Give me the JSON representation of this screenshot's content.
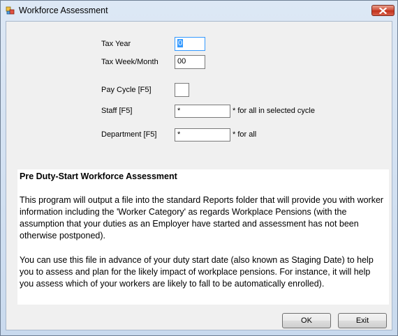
{
  "window": {
    "title": "Workforce Assessment",
    "close_label": "✕"
  },
  "form": {
    "tax_year_label": "Tax Year",
    "tax_year_value": "0",
    "tax_week_label": "Tax Week/Month",
    "tax_week_value": "00",
    "pay_cycle_label": "Pay Cycle [F5]",
    "pay_cycle_value": "",
    "staff_label": "Staff [F5]",
    "staff_value": "*",
    "staff_hint": "* for all in selected cycle",
    "department_label": "Department [F5]",
    "department_value": "*",
    "department_hint": "* for all"
  },
  "info": {
    "heading": "Pre Duty-Start Workforce Assessment",
    "paragraph1": "This program will output a file into the standard Reports folder that will provide you with worker information including the 'Worker Category' as regards Workplace Pensions (with the assumption that your duties as an Employer have started and assessment has not been otherwise postponed).",
    "paragraph2": "You can use this file in advance of your duty start date (also known as Staging Date) to help you to assess and plan for the likely impact of workplace pensions.  For instance, it will help you assess which of your workers are likely to fall to be automatically enrolled)."
  },
  "buttons": {
    "ok_label": "OK",
    "exit_label": "Exit"
  },
  "colors": {
    "focus_border": "#3399ff",
    "close_button": "#c0301a"
  }
}
